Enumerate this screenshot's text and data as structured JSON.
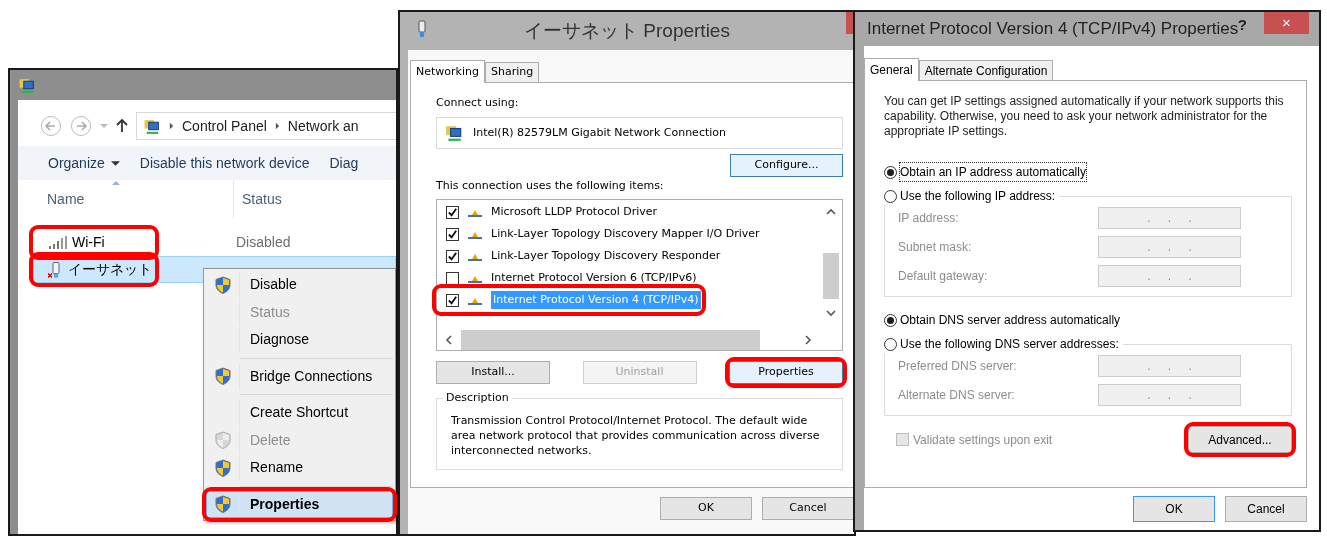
{
  "explorer": {
    "breadcrumb": [
      "Control Panel",
      "Network an"
    ],
    "toolbar": [
      {
        "label": "Organize",
        "dropdown": true
      },
      {
        "label": "Disable this network device",
        "dropdown": false
      },
      {
        "label": "Diag",
        "dropdown": false
      }
    ],
    "columns": [
      "Name",
      "Status"
    ],
    "rows": [
      {
        "name": "Wi-Fi",
        "status": "Disabled",
        "kind": "wifi",
        "selected": false,
        "highlighted": true
      },
      {
        "name": "イーサネット",
        "kind": "ethernet",
        "selected": true,
        "highlighted": true
      }
    ],
    "context_menu": [
      {
        "kind": "item",
        "label": "Disable",
        "shield": true,
        "disabled": false,
        "default": false,
        "selected": false,
        "highlighted": false
      },
      {
        "kind": "item",
        "label": "Status",
        "shield": false,
        "disabled": true,
        "default": false,
        "selected": false,
        "highlighted": false
      },
      {
        "kind": "item",
        "label": "Diagnose",
        "shield": false,
        "disabled": false,
        "default": false,
        "selected": false,
        "highlighted": false
      },
      {
        "kind": "separator"
      },
      {
        "kind": "item",
        "label": "Bridge Connections",
        "shield": true,
        "disabled": false,
        "default": false,
        "selected": false,
        "highlighted": false
      },
      {
        "kind": "separator"
      },
      {
        "kind": "item",
        "label": "Create Shortcut",
        "shield": false,
        "disabled": false,
        "default": false,
        "selected": false,
        "highlighted": false
      },
      {
        "kind": "item",
        "label": "Delete",
        "shield": true,
        "disabled": true,
        "default": false,
        "selected": false,
        "highlighted": false
      },
      {
        "kind": "item",
        "label": "Rename",
        "shield": true,
        "disabled": false,
        "default": false,
        "selected": false,
        "highlighted": false
      },
      {
        "kind": "separator"
      },
      {
        "kind": "item",
        "label": "Properties",
        "shield": true,
        "disabled": false,
        "default": true,
        "selected": true,
        "highlighted": true
      }
    ]
  },
  "adapter_properties": {
    "title": "イーサネット Properties",
    "tabs": [
      {
        "label": "Networking",
        "selected": true
      },
      {
        "label": "Sharing",
        "selected": false
      }
    ],
    "connect_label": "Connect using:",
    "adapter": "Intel(R) 82579LM Gigabit Network Connection",
    "configure": {
      "label": "Configure...",
      "focused": true
    },
    "items_label": "This connection uses the following items:",
    "items": [
      {
        "label": "Microsoft LLDP Protocol Driver",
        "checked": true,
        "selected": false,
        "highlighted": false
      },
      {
        "label": "Link-Layer Topology Discovery Mapper I/O Driver",
        "checked": true,
        "selected": false,
        "highlighted": false
      },
      {
        "label": "Link-Layer Topology Discovery Responder",
        "checked": true,
        "selected": false,
        "highlighted": false
      },
      {
        "label": "Internet Protocol Version 6 (TCP/IPv6)",
        "checked": false,
        "selected": false,
        "highlighted": false
      },
      {
        "label": "Internet Protocol Version 4 (TCP/IPv4)",
        "checked": true,
        "selected": true,
        "highlighted": true
      }
    ],
    "buttons": [
      {
        "label": "Install...",
        "disabled": false,
        "focused": false,
        "highlighted": false
      },
      {
        "label": "Uninstall",
        "disabled": true,
        "focused": false,
        "highlighted": false
      },
      {
        "label": "Properties",
        "disabled": false,
        "focused": true,
        "highlighted": true
      }
    ],
    "description_title": "Description",
    "description": "Transmission Control Protocol/Internet Protocol. The default wide area network protocol that provides communication across diverse interconnected networks.",
    "footer": [
      "OK",
      "Cancel"
    ]
  },
  "ipv4_properties": {
    "title": "Internet Protocol Version 4 (TCP/IPv4) Properties",
    "help": "?",
    "close": "×",
    "tabs": [
      {
        "label": "General",
        "selected": true
      },
      {
        "label": "Alternate Configuration",
        "selected": false
      }
    ],
    "intro": "You can get IP settings assigned automatically if your network supports this capability. Otherwise, you need to ask your network administrator for the appropriate IP settings.",
    "ip_options": [
      {
        "label": "Obtain an IP address automatically",
        "selected": true
      },
      {
        "label": "Use the following IP address:",
        "selected": false
      }
    ],
    "ip_fields": [
      {
        "label": "IP address:",
        "value": ". . .",
        "disabled": true
      },
      {
        "label": "Subnet mask:",
        "value": ". . .",
        "disabled": true
      },
      {
        "label": "Default gateway:",
        "value": ". . .",
        "disabled": true
      }
    ],
    "dns_options": [
      {
        "label": "Obtain DNS server address automatically",
        "selected": true
      },
      {
        "label": "Use the following DNS server addresses:",
        "selected": false
      }
    ],
    "dns_fields": [
      {
        "label": "Preferred DNS server:",
        "value": ". . .",
        "disabled": true
      },
      {
        "label": "Alternate DNS server:",
        "value": ". . .",
        "disabled": true
      }
    ],
    "validate": {
      "label": "Validate settings upon exit",
      "checked": false,
      "disabled": true
    },
    "advanced": {
      "label": "Advanced...",
      "highlighted": true
    },
    "footer": [
      {
        "label": "OK",
        "default": true
      },
      {
        "label": "Cancel",
        "default": false
      }
    ]
  }
}
